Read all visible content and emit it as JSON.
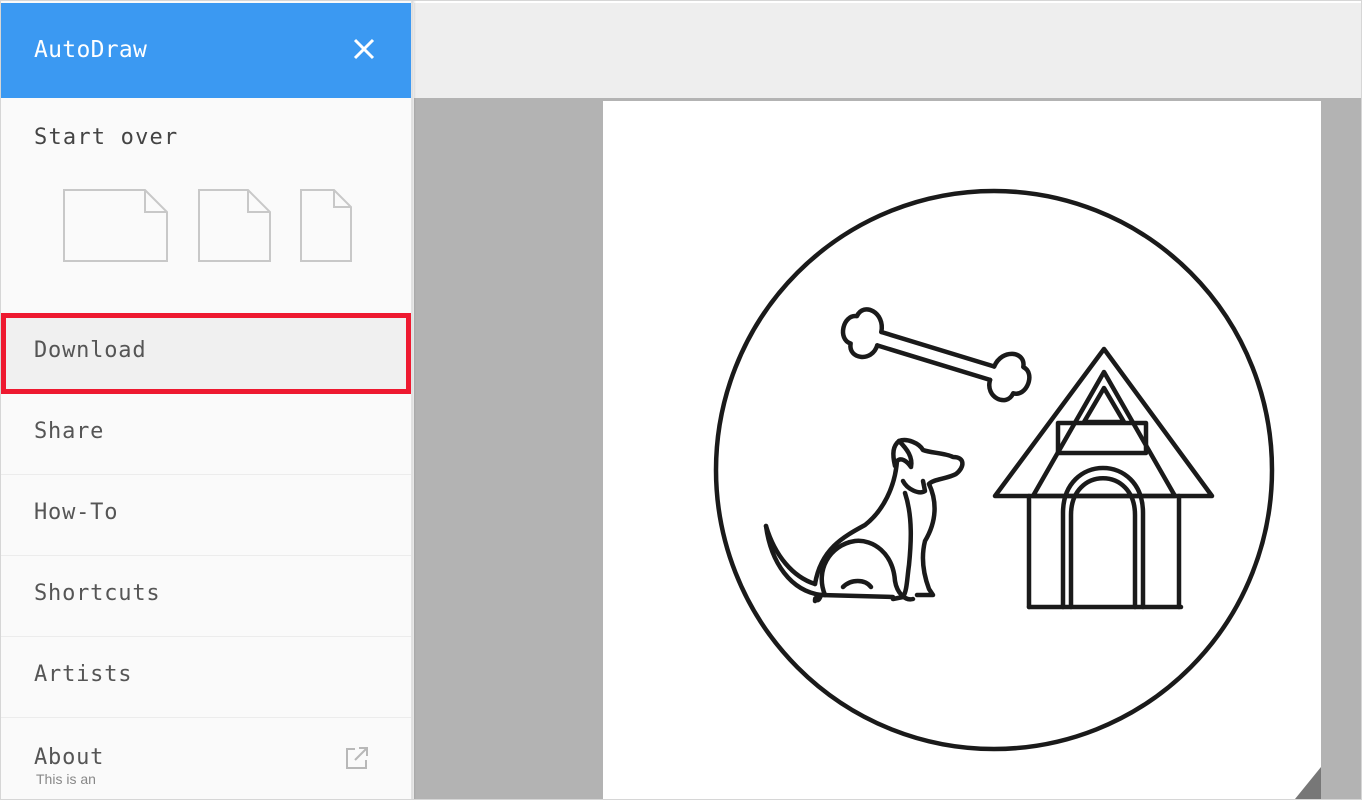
{
  "app": {
    "title": "AutoDraw"
  },
  "sidebar": {
    "close_icon": "close-icon",
    "start_over": {
      "label": "Start over",
      "options": [
        "landscape",
        "square",
        "portrait"
      ]
    },
    "menu_items": [
      {
        "id": "download",
        "label": "Download",
        "highlighted": true
      },
      {
        "id": "share",
        "label": "Share"
      },
      {
        "id": "how-to",
        "label": "How-To"
      },
      {
        "id": "shortcuts",
        "label": "Shortcuts"
      },
      {
        "id": "artists",
        "label": "Artists"
      },
      {
        "id": "about",
        "label": "About",
        "icon": "external-link-icon",
        "subtext": "This is an"
      }
    ]
  },
  "canvas": {
    "illustration": "dog-bone-doghouse-in-circle",
    "colors": {
      "stroke": "#1a1a1a",
      "background": "#b3b3b3",
      "paper": "#ffffff"
    }
  },
  "colors": {
    "accent": "#3b99f2",
    "highlight_border": "#ee1930"
  }
}
